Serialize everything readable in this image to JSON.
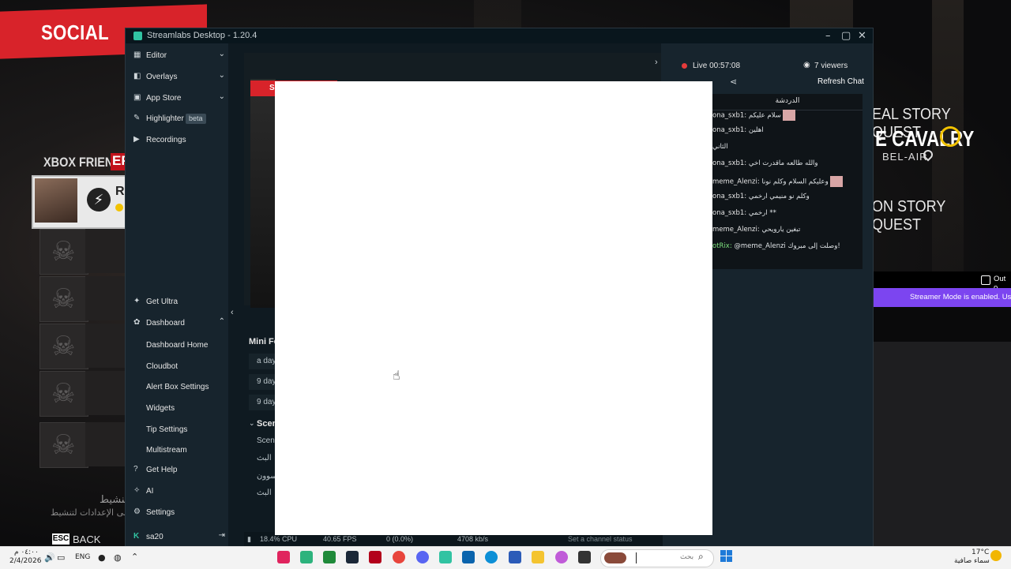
{
  "game": {
    "social": "SOCIAL",
    "xbox_friends": "XBOX FRIENDS",
    "epi_fragment": "EPI",
    "friend_fragment": "R",
    "quest_1": "EAL STORY QUEST",
    "cavalry": "E CAVALRY",
    "belair": "BEL-AIR",
    "quest_2": "ON STORY QUEST",
    "back": "BACK",
    "esc": "ESC"
  },
  "windows_watermark": {
    "line1": "تنشيط Windows",
    "line2": "انتقل إلى الإعدادات لتنشيط Windows."
  },
  "streamlabs": {
    "title": "Streamlabs Desktop - 1.20.4",
    "window_buttons": [
      "–",
      "▢",
      "✕"
    ],
    "sidebar": {
      "editor": "Editor",
      "overlays": "Overlays",
      "app_store": "App Store",
      "highlighter": "Highlighter",
      "beta": "beta",
      "recordings": "Recordings",
      "get_ultra": "Get Ultra",
      "dashboard": "Dashboard",
      "dashboard_home": "Dashboard Home",
      "cloudbot": "Cloudbot",
      "alert_box_settings": "Alert Box Settings",
      "widgets": "Widgets",
      "tip_settings": "Tip Settings",
      "multistream": "Multistream",
      "get_help": "Get Help",
      "ai": "AI",
      "settings": "Settings",
      "user": "sa20"
    },
    "main": {
      "preview_label": "SOCIAL",
      "mini_feed_title": "Mini Fe",
      "feed_rows": [
        "a day",
        "9 day",
        "9 day"
      ],
      "scenes_title": "Scen",
      "scene_rows": [
        "Scene",
        "البث",
        "سوون",
        "البث"
      ]
    },
    "status": {
      "cpu": "18.4% CPU",
      "fps": "40.65 FPS",
      "dropped": "0 (0.0%)",
      "bitrate": "4708 kb/s",
      "channel_status": "Set a channel status"
    },
    "chat": {
      "live": "Live 00:57:08",
      "viewers": "7 viewers",
      "refresh": "Refresh Chat",
      "header": "الدردشة",
      "messages": [
        {
          "user": "ona_sxb1:",
          "text": "سلام عليكم",
          "emote": true,
          "bot": false
        },
        {
          "user": "ona_sxb1:",
          "text": "اهلين",
          "emote": false,
          "bot": false
        },
        {
          "user": "",
          "text": "الثاني",
          "emote": false,
          "bot": false
        },
        {
          "user": "ona_sxb1:",
          "text": "والله طالعه ماقدرت اخي",
          "emote": false,
          "bot": false
        },
        {
          "user": "meme_Alenzi:",
          "text": "وعليكم السلام وكلم نونا",
          "emote": true,
          "bot": false
        },
        {
          "user": "ona_sxb1:",
          "text": "وكلم نو منيمي ارخمي",
          "emote": false,
          "bot": false
        },
        {
          "user": "ona_sxb1:",
          "text": "ارخمي **",
          "emote": false,
          "bot": false
        },
        {
          "user": "meme_Alenzi:",
          "text": "تبغين يارويحي",
          "emote": false,
          "bot": false
        },
        {
          "user": "otRix:",
          "text": "@meme_Alenzi وصلت إلى مبروك!",
          "emote": false,
          "bot": true
        }
      ]
    }
  },
  "overlay": {
    "out_label": "Out o",
    "streamer_mode": "Streamer Mode is enabled. User"
  },
  "taskbar": {
    "time": "٠٤:٠٠ م",
    "date": "2/4/2026",
    "lang": "ENG",
    "search_placeholder": "بحث",
    "weather_temp": "17°C",
    "weather_desc": "سماء صافية"
  },
  "colors": {
    "accent_teal": "#31c3a2",
    "live_red": "#e53b3b",
    "streamer_purple": "#7c45f0",
    "social_red": "#d8232a"
  }
}
